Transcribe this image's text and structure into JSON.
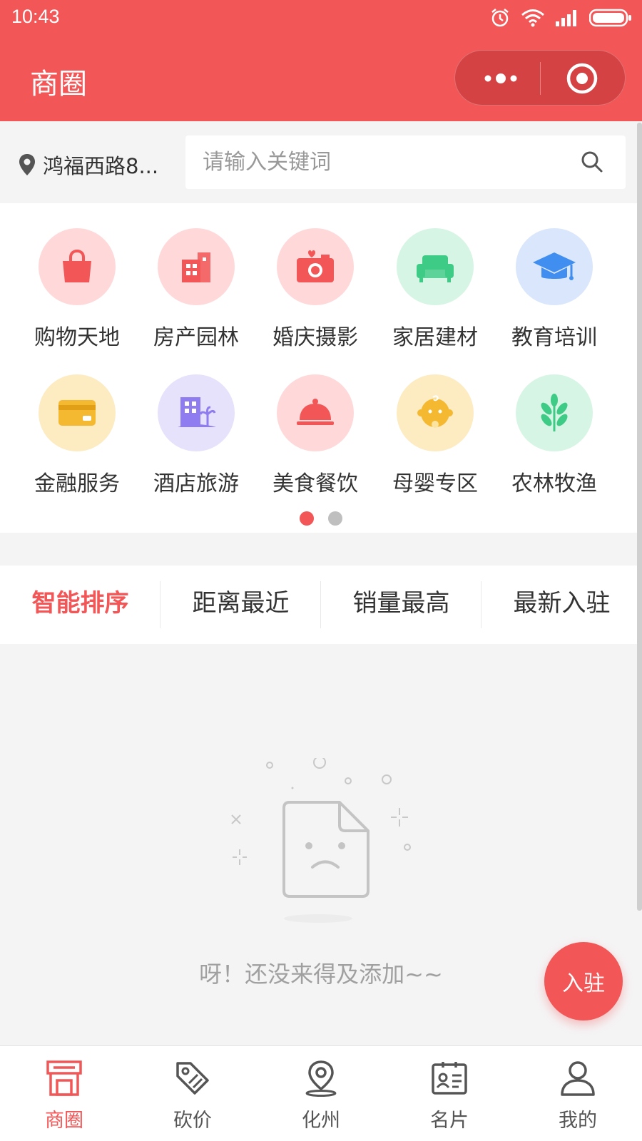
{
  "status": {
    "time": "10:43"
  },
  "header": {
    "title": "商圈"
  },
  "search": {
    "location": "鸿福西路8...",
    "placeholder": "请输入关键词"
  },
  "categories": [
    {
      "label": "购物天地",
      "icon": "shopping-bag-icon",
      "bg": "#ffd9d9",
      "color": "#f25656"
    },
    {
      "label": "房产园林",
      "icon": "building-icon",
      "bg": "#ffd9d9",
      "color": "#f25656"
    },
    {
      "label": "婚庆摄影",
      "icon": "camera-icon",
      "bg": "#ffd9d9",
      "color": "#f25656"
    },
    {
      "label": "家居建材",
      "icon": "sofa-icon",
      "bg": "#d6f5e5",
      "color": "#3ecb86"
    },
    {
      "label": "教育培训",
      "icon": "graduation-cap-icon",
      "bg": "#d9e6fb",
      "color": "#3f8ef0"
    },
    {
      "label": "金融服务",
      "icon": "credit-card-icon",
      "bg": "#fdebc2",
      "color": "#f5b931"
    },
    {
      "label": "酒店旅游",
      "icon": "hotel-icon",
      "bg": "#e6e2fb",
      "color": "#8f7cf0"
    },
    {
      "label": "美食餐饮",
      "icon": "food-cloche-icon",
      "bg": "#ffd9d9",
      "color": "#f25656"
    },
    {
      "label": "母婴专区",
      "icon": "baby-icon",
      "bg": "#fdebc2",
      "color": "#f5b931"
    },
    {
      "label": "农林牧渔",
      "icon": "wheat-icon",
      "bg": "#d6f5e5",
      "color": "#3ecb86"
    }
  ],
  "pager": {
    "pages": 2,
    "current": 1
  },
  "sort": {
    "options": [
      "智能排序",
      "距离最近",
      "销量最高",
      "最新入驻"
    ],
    "active": 0
  },
  "empty": {
    "message": "呀！还没来得及添加~~"
  },
  "fab": {
    "label": "入驻"
  },
  "tabbar": {
    "items": [
      {
        "label": "商圈",
        "icon": "store-icon"
      },
      {
        "label": "砍价",
        "icon": "price-tag-icon"
      },
      {
        "label": "化州",
        "icon": "location-pin-icon"
      },
      {
        "label": "名片",
        "icon": "business-card-icon"
      },
      {
        "label": "我的",
        "icon": "user-icon"
      }
    ],
    "active": 0
  },
  "colors": {
    "accent": "#f25656",
    "inactive": "#555555"
  }
}
